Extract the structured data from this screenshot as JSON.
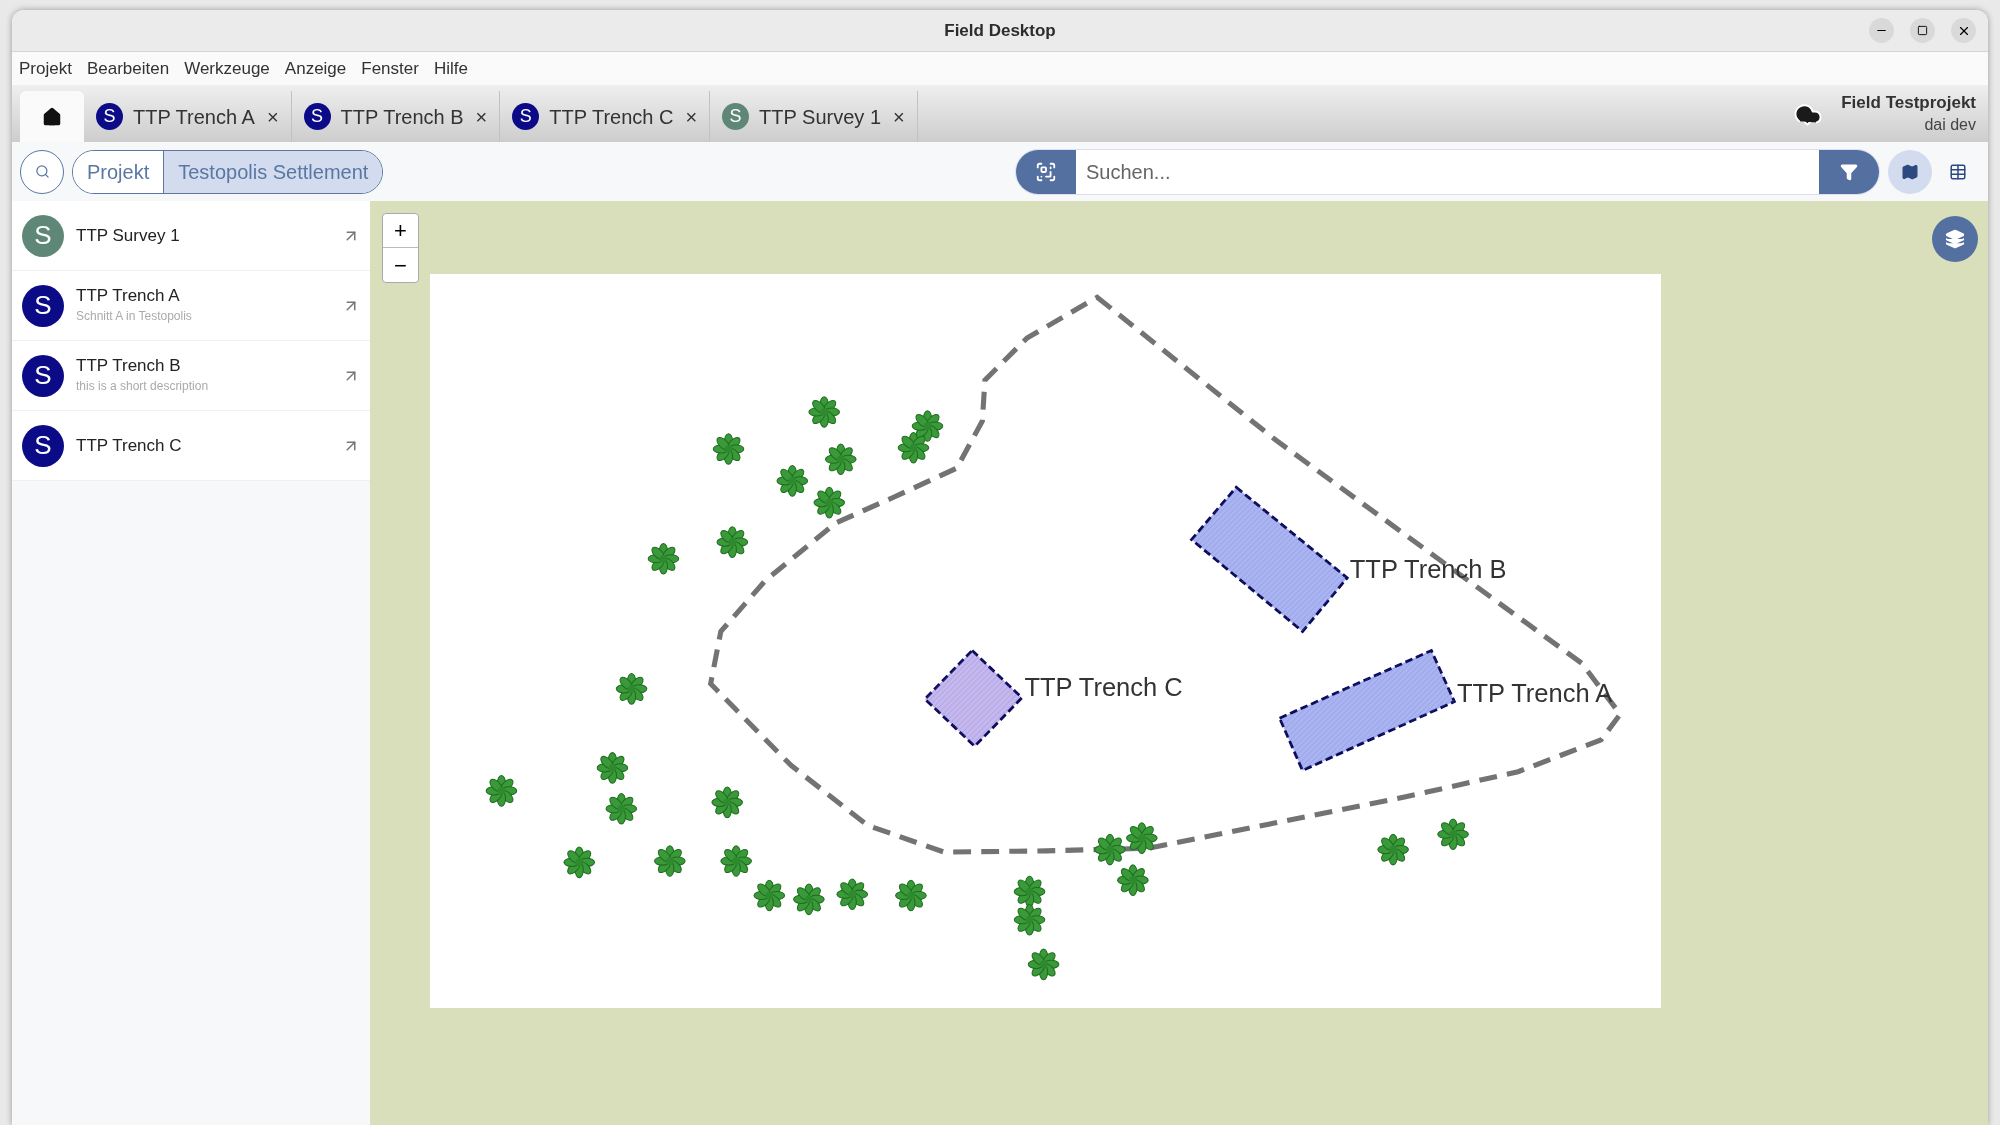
{
  "window": {
    "title": "Field Desktop"
  },
  "menu": [
    "Projekt",
    "Bearbeiten",
    "Werkzeuge",
    "Anzeige",
    "Fenster",
    "Hilfe"
  ],
  "tabs": [
    {
      "kind": "home",
      "selected": true
    },
    {
      "kind": "document",
      "avatar": "S",
      "label": "TTP Trench A",
      "close": "×",
      "color": "#0b0b87",
      "selected": false
    },
    {
      "kind": "document",
      "avatar": "S",
      "label": "TTP Trench B",
      "close": "×",
      "color": "#0b0b87",
      "selected": false
    },
    {
      "kind": "document",
      "avatar": "S",
      "label": "TTP Trench C",
      "close": "×",
      "color": "#0b0b87",
      "selected": false
    },
    {
      "kind": "document",
      "avatar": "S",
      "label": "TTP Survey 1",
      "close": "×",
      "color": "#5f8777",
      "selected": false
    }
  ],
  "project": {
    "name": "Field Testprojekt",
    "user": "dai dev"
  },
  "breadcrumb": [
    {
      "label": "Projekt",
      "selected": false
    },
    {
      "label": "Testopolis Settlement",
      "selected": true
    }
  ],
  "search": {
    "placeholder": "Suchen..."
  },
  "view_buttons": [
    {
      "kind": "map",
      "selected": true
    },
    {
      "kind": "table",
      "selected": false
    }
  ],
  "sidebar": {
    "items": [
      {
        "avatar": "S",
        "name": "TTP Survey 1",
        "color": "#5f8777"
      },
      {
        "avatar": "S",
        "name": "TTP Trench A",
        "description": "Schnitt A in Testopolis",
        "color": "#0b0b87"
      },
      {
        "avatar": "S",
        "name": "TTP Trench B",
        "description": "this is a short description",
        "color": "#0b0b87"
      },
      {
        "avatar": "S",
        "name": "TTP Trench C",
        "color": "#0b0b87"
      }
    ]
  },
  "map": {
    "zoom_in": "+",
    "zoom_out": "−",
    "features": [
      {
        "label": "TTP Trench B",
        "color": "#aab4f0"
      },
      {
        "label": "TTP Trench C",
        "color": "#c6b7ec"
      },
      {
        "label": "TTP Trench A",
        "color": "#aab4f0"
      }
    ]
  }
}
